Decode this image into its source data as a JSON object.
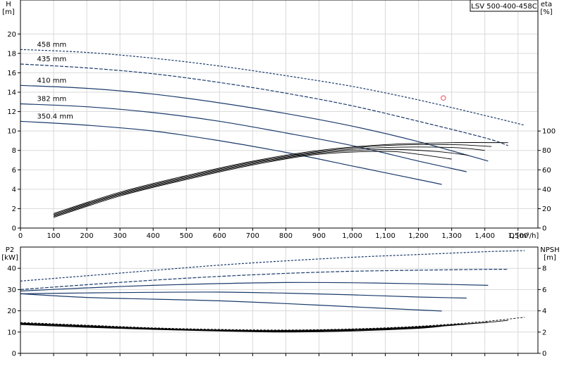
{
  "chart_data": [
    {
      "type": "line",
      "title": "LSV 500-400-458C",
      "xlabel": "Q [m³/h]",
      "ylabel_left": "H\n[m]",
      "ylabel_right": "eta\n[%]",
      "xlim": [
        0,
        1560
      ],
      "ylim_left": [
        0,
        23.5
      ],
      "ylim_right": [
        0,
        235
      ],
      "x_ticks": [
        0,
        100,
        200,
        300,
        400,
        500,
        600,
        700,
        800,
        900,
        1000,
        1100,
        1200,
        1300,
        1400,
        1500
      ],
      "x_tick_labels": [
        "0",
        "100",
        "200",
        "300",
        "400",
        "500",
        "600",
        "700",
        "800",
        "900",
        "1,000",
        "1,100",
        "1,200",
        "1,300",
        "1,400",
        "1,500"
      ],
      "y_ticks_left": [
        0,
        2,
        4,
        6,
        8,
        10,
        12,
        14,
        16,
        18,
        20
      ],
      "y_ticks_right": [
        0,
        20,
        40,
        60,
        80,
        100
      ],
      "grid": true,
      "series": [
        {
          "name": "458 mm",
          "axis": "left",
          "style": "dashed",
          "x": [
            0,
            200,
            400,
            600,
            800,
            1000,
            1200,
            1400,
            1520
          ],
          "y": [
            18.4,
            18.1,
            17.5,
            16.7,
            15.7,
            14.6,
            13.2,
            11.6,
            10.6
          ]
        },
        {
          "name": "435 mm",
          "axis": "left",
          "style": "mixed",
          "x": [
            0,
            200,
            400,
            600,
            800,
            1000,
            1200,
            1400,
            1470
          ],
          "y": [
            16.9,
            16.5,
            15.9,
            15.0,
            13.9,
            12.6,
            11.0,
            9.3,
            8.5
          ]
        },
        {
          "name": "410 mm",
          "axis": "left",
          "style": "solid",
          "x": [
            0,
            200,
            400,
            600,
            800,
            1000,
            1200,
            1410
          ],
          "y": [
            14.7,
            14.4,
            13.8,
            12.9,
            11.8,
            10.5,
            8.9,
            6.9
          ]
        },
        {
          "name": "382 mm",
          "axis": "left",
          "style": "solid",
          "x": [
            0,
            200,
            400,
            600,
            800,
            1000,
            1200,
            1345
          ],
          "y": [
            12.8,
            12.5,
            11.9,
            11.0,
            9.8,
            8.5,
            6.9,
            5.8
          ]
        },
        {
          "name": "350.4 mm",
          "axis": "left",
          "style": "solid",
          "x": [
            0,
            200,
            400,
            600,
            800,
            1000,
            1200,
            1270
          ],
          "y": [
            11.0,
            10.6,
            10.0,
            9.0,
            7.8,
            6.4,
            5.0,
            4.5
          ]
        },
        {
          "axis": "right",
          "style": "solid",
          "x": [
            100,
            300,
            500,
            700,
            900,
            1100,
            1300,
            1470
          ],
          "y": [
            15,
            37,
            54,
            69,
            80,
            86,
            88,
            88
          ]
        },
        {
          "axis": "right",
          "style": "solid",
          "x": [
            100,
            300,
            500,
            700,
            900,
            1100,
            1300,
            1420
          ],
          "y": [
            14,
            36,
            53,
            68,
            79,
            85,
            86,
            84
          ]
        },
        {
          "axis": "right",
          "style": "solid",
          "x": [
            100,
            300,
            500,
            700,
            900,
            1100,
            1300,
            1400
          ],
          "y": [
            13,
            35,
            52,
            67,
            78,
            83,
            83,
            80
          ]
        },
        {
          "axis": "right",
          "style": "solid",
          "x": [
            100,
            300,
            500,
            700,
            900,
            1100,
            1250,
            1350
          ],
          "y": [
            12,
            34,
            51,
            66,
            77,
            81,
            79,
            75
          ]
        },
        {
          "axis": "right",
          "style": "solid",
          "x": [
            100,
            300,
            500,
            700,
            900,
            1100,
            1200,
            1300
          ],
          "y": [
            11,
            33,
            50,
            65,
            76,
            79,
            76,
            71
          ]
        }
      ],
      "annotations": [
        {
          "type": "marker",
          "shape": "circle",
          "color": "#e0505a",
          "x": 1275,
          "y": 13.4
        }
      ],
      "colors": {
        "curve": "#1a3a6b",
        "eta": "#000000",
        "grid": "#d9d9d9"
      }
    },
    {
      "type": "line",
      "xlabel": "",
      "ylabel_left": "P2\n[kW]",
      "ylabel_right": "NPSH\n[m]",
      "xlim": [
        0,
        1560
      ],
      "ylim_left": [
        0,
        50
      ],
      "ylim_right": [
        0,
        10
      ],
      "y_ticks_left": [
        0,
        10,
        20,
        30,
        40
      ],
      "y_ticks_right": [
        0,
        2,
        4,
        6,
        8
      ],
      "grid": true,
      "series": [
        {
          "axis": "left",
          "style": "dashed",
          "x": [
            0,
            200,
            400,
            600,
            800,
            1000,
            1200,
            1400,
            1520
          ],
          "y": [
            34,
            36.5,
            39,
            41.5,
            43.5,
            45.2,
            46.5,
            47.8,
            48.3
          ]
        },
        {
          "axis": "left",
          "style": "mixed",
          "x": [
            0,
            200,
            400,
            600,
            800,
            1000,
            1200,
            1400,
            1470
          ],
          "y": [
            30,
            32.3,
            34.4,
            36.2,
            37.6,
            38.6,
            39.1,
            39.5,
            39.5
          ]
        },
        {
          "axis": "left",
          "style": "solid",
          "x": [
            0,
            200,
            400,
            600,
            800,
            1000,
            1200,
            1410
          ],
          "y": [
            29.3,
            30.8,
            32.0,
            32.8,
            33.3,
            33.2,
            32.7,
            32.0
          ]
        },
        {
          "axis": "left",
          "style": "solid",
          "x": [
            0,
            200,
            400,
            600,
            800,
            1000,
            1200,
            1345
          ],
          "y": [
            28.0,
            28.4,
            28.7,
            28.8,
            28.3,
            27.5,
            26.5,
            26.0
          ]
        },
        {
          "axis": "left",
          "style": "solid",
          "x": [
            0,
            200,
            400,
            600,
            800,
            1000,
            1200,
            1270
          ],
          "y": [
            28.0,
            26.3,
            25.5,
            24.7,
            23.4,
            21.9,
            20.4,
            19.9
          ]
        },
        {
          "axis": "right",
          "style": "dashed",
          "x": [
            0,
            200,
            400,
            600,
            800,
            1000,
            1200,
            1400,
            1520
          ],
          "y": [
            2.9,
            2.65,
            2.4,
            2.25,
            2.2,
            2.3,
            2.55,
            3.0,
            3.4
          ]
        },
        {
          "axis": "right",
          "style": "solid",
          "x": [
            0,
            200,
            400,
            600,
            800,
            1000,
            1200,
            1400,
            1470
          ],
          "y": [
            2.85,
            2.6,
            2.35,
            2.2,
            2.15,
            2.25,
            2.5,
            2.9,
            3.1
          ]
        },
        {
          "axis": "right",
          "style": "solid",
          "x": [
            0,
            200,
            400,
            600,
            800,
            1000,
            1200,
            1410
          ],
          "y": [
            2.8,
            2.55,
            2.3,
            2.15,
            2.1,
            2.2,
            2.45,
            2.9
          ]
        },
        {
          "axis": "right",
          "style": "solid",
          "x": [
            0,
            200,
            400,
            600,
            800,
            1000,
            1200,
            1345
          ],
          "y": [
            2.75,
            2.5,
            2.3,
            2.12,
            2.05,
            2.15,
            2.4,
            2.75
          ]
        },
        {
          "axis": "right",
          "style": "solid",
          "x": [
            0,
            200,
            400,
            600,
            800,
            1000,
            1200,
            1270
          ],
          "y": [
            2.7,
            2.45,
            2.25,
            2.1,
            2.0,
            2.1,
            2.35,
            2.55
          ]
        }
      ],
      "colors": {
        "curve": "#1a3a6b",
        "npsh": "#000000",
        "grid": "#d9d9d9"
      }
    }
  ]
}
